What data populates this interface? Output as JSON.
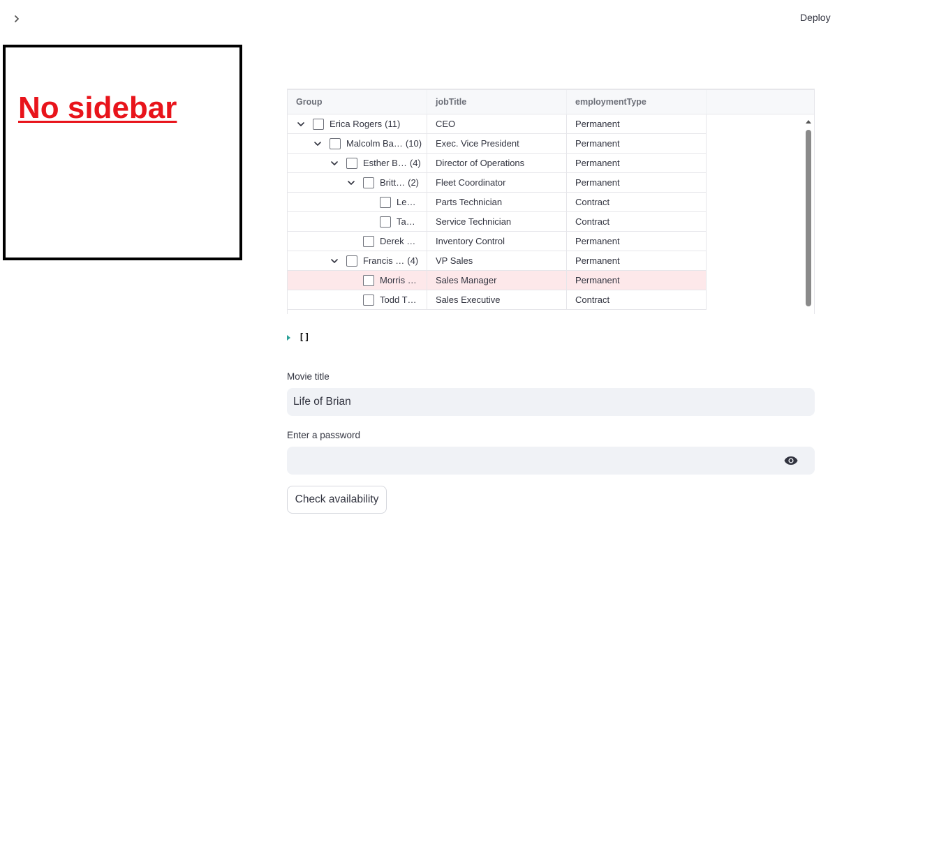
{
  "header": {
    "expand_icon": "chevron-right-icon",
    "deploy_label": "Deploy"
  },
  "sidebar_placeholder": {
    "text": "No sidebar"
  },
  "grid": {
    "columns": [
      "Group",
      "jobTitle",
      "employmentType"
    ],
    "rows": [
      {
        "name": "Erica Rogers",
        "count": "(11)",
        "level": 0,
        "expanded": true,
        "jobTitle": "CEO",
        "employmentType": "Permanent",
        "selected": false
      },
      {
        "name": "Malcolm Ba…",
        "count": "(10)",
        "level": 1,
        "expanded": true,
        "jobTitle": "Exec. Vice President",
        "employmentType": "Permanent",
        "selected": false
      },
      {
        "name": "Esther B…",
        "count": "(4)",
        "level": 2,
        "expanded": true,
        "jobTitle": "Director of Operations",
        "employmentType": "Permanent",
        "selected": false
      },
      {
        "name": "Britt…",
        "count": "(2)",
        "level": 3,
        "expanded": true,
        "jobTitle": "Fleet Coordinator",
        "employmentType": "Permanent",
        "selected": false
      },
      {
        "name": "Le…",
        "count": "",
        "level": 4,
        "expanded": null,
        "jobTitle": "Parts Technician",
        "employmentType": "Contract",
        "selected": false
      },
      {
        "name": "Ta…",
        "count": "",
        "level": 4,
        "expanded": null,
        "jobTitle": "Service Technician",
        "employmentType": "Contract",
        "selected": false
      },
      {
        "name": "Derek …",
        "count": "",
        "level": 3,
        "expanded": null,
        "jobTitle": "Inventory Control",
        "employmentType": "Permanent",
        "selected": false
      },
      {
        "name": "Francis …",
        "count": "(4)",
        "level": 2,
        "expanded": true,
        "jobTitle": "VP Sales",
        "employmentType": "Permanent",
        "selected": false
      },
      {
        "name": "Morris …",
        "count": "",
        "level": 3,
        "expanded": null,
        "jobTitle": "Sales Manager",
        "employmentType": "Permanent",
        "selected": true
      },
      {
        "name": "Todd T…",
        "count": "",
        "level": 3,
        "expanded": null,
        "jobTitle": "Sales Executive",
        "employmentType": "Contract",
        "selected": false
      }
    ]
  },
  "json_output": {
    "value": "[]"
  },
  "movie_title": {
    "label": "Movie title",
    "value": "Life of Brian"
  },
  "password": {
    "label": "Enter a password",
    "value": "",
    "icon": "eye-icon"
  },
  "check_button": {
    "label": "Check availability"
  },
  "colors": {
    "selected_row": "#fde8ea",
    "sidebar_text": "#e8141b",
    "json_caret": "#2aa198"
  }
}
